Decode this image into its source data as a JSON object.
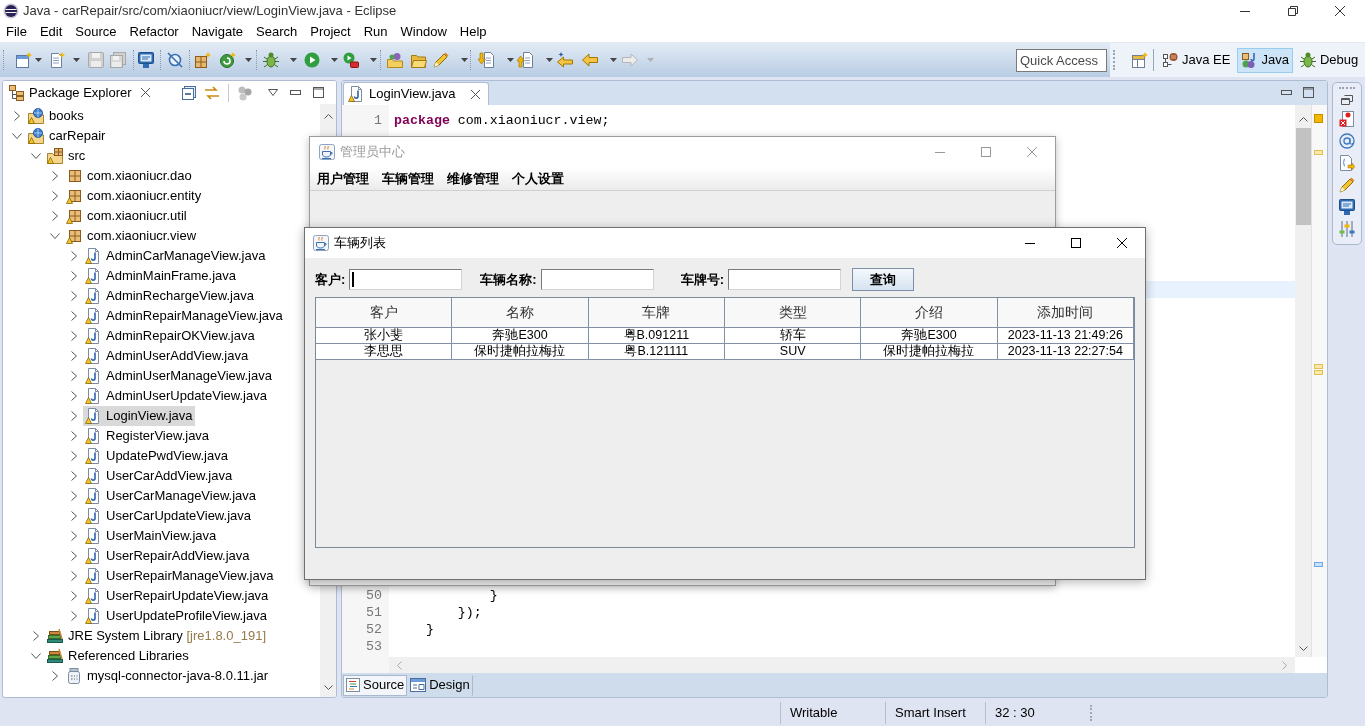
{
  "window": {
    "title": "Java - carRepair/src/com/xiaoniucr/view/LoginView.java - Eclipse"
  },
  "menu_bar": [
    "File",
    "Edit",
    "Source",
    "Refactor",
    "Navigate",
    "Search",
    "Project",
    "Run",
    "Window",
    "Help"
  ],
  "toolbar": {
    "quick_access": {
      "placeholder": "Quick Access"
    },
    "perspectives": [
      {
        "label": "Java EE",
        "selected": false
      },
      {
        "label": "Java",
        "selected": true
      },
      {
        "label": "Debug",
        "selected": false
      }
    ]
  },
  "package_explorer": {
    "title": "Package Explorer",
    "tree": [
      {
        "label": "books",
        "kind": "project",
        "expanded": false,
        "selected": false,
        "warning": true
      },
      {
        "label": "carRepair",
        "kind": "project",
        "expanded": true,
        "selected": false,
        "warning": true,
        "children": [
          {
            "label": "src",
            "kind": "source_folder",
            "expanded": true,
            "selected": false,
            "warning": true,
            "children": [
              {
                "label": "com.xiaoniucr.dao",
                "kind": "package",
                "expanded": false,
                "selected": false,
                "warning": false
              },
              {
                "label": "com.xiaoniucr.entity",
                "kind": "package",
                "expanded": false,
                "selected": false,
                "warning": true
              },
              {
                "label": "com.xiaoniucr.util",
                "kind": "package",
                "expanded": false,
                "selected": false,
                "warning": true
              },
              {
                "label": "com.xiaoniucr.view",
                "kind": "package",
                "expanded": true,
                "selected": false,
                "warning": true,
                "children": [
                  {
                    "label": "AdminCarManageView.java",
                    "kind": "java_file",
                    "expanded": false,
                    "selected": false,
                    "warning": true
                  },
                  {
                    "label": "AdminMainFrame.java",
                    "kind": "java_file",
                    "expanded": false,
                    "selected": false,
                    "warning": true
                  },
                  {
                    "label": "AdminRechargeView.java",
                    "kind": "java_file",
                    "expanded": false,
                    "selected": false,
                    "warning": true
                  },
                  {
                    "label": "AdminRepairManageView.java",
                    "kind": "java_file",
                    "expanded": false,
                    "selected": false,
                    "warning": true
                  },
                  {
                    "label": "AdminRepairOKView.java",
                    "kind": "java_file",
                    "expanded": false,
                    "selected": false,
                    "warning": true
                  },
                  {
                    "label": "AdminUserAddView.java",
                    "kind": "java_file",
                    "expanded": false,
                    "selected": false,
                    "warning": true
                  },
                  {
                    "label": "AdminUserManageView.java",
                    "kind": "java_file",
                    "expanded": false,
                    "selected": false,
                    "warning": true
                  },
                  {
                    "label": "AdminUserUpdateView.java",
                    "kind": "java_file",
                    "expanded": false,
                    "selected": false,
                    "warning": true
                  },
                  {
                    "label": "LoginView.java",
                    "kind": "java_file",
                    "expanded": false,
                    "selected": true,
                    "warning": true
                  },
                  {
                    "label": "RegisterView.java",
                    "kind": "java_file",
                    "expanded": false,
                    "selected": false,
                    "warning": true
                  },
                  {
                    "label": "UpdatePwdView.java",
                    "kind": "java_file",
                    "expanded": false,
                    "selected": false,
                    "warning": true
                  },
                  {
                    "label": "UserCarAddView.java",
                    "kind": "java_file",
                    "expanded": false,
                    "selected": false,
                    "warning": true
                  },
                  {
                    "label": "UserCarManageView.java",
                    "kind": "java_file",
                    "expanded": false,
                    "selected": false,
                    "warning": true
                  },
                  {
                    "label": "UserCarUpdateView.java",
                    "kind": "java_file",
                    "expanded": false,
                    "selected": false,
                    "warning": true
                  },
                  {
                    "label": "UserMainView.java",
                    "kind": "java_file",
                    "expanded": false,
                    "selected": false,
                    "warning": true
                  },
                  {
                    "label": "UserRepairAddView.java",
                    "kind": "java_file",
                    "expanded": false,
                    "selected": false,
                    "warning": true
                  },
                  {
                    "label": "UserRepairManageView.java",
                    "kind": "java_file",
                    "expanded": false,
                    "selected": false,
                    "warning": true
                  },
                  {
                    "label": "UserRepairUpdateView.java",
                    "kind": "java_file",
                    "expanded": false,
                    "selected": false,
                    "warning": true
                  },
                  {
                    "label": "UserUpdateProfileView.java",
                    "kind": "java_file",
                    "expanded": false,
                    "selected": false,
                    "warning": true
                  }
                ]
              }
            ]
          },
          {
            "label": "JRE System Library",
            "decoration": "[jre1.8.0_191]",
            "kind": "library",
            "expanded": false,
            "selected": false,
            "warning": false
          },
          {
            "label": "Referenced Libraries",
            "kind": "library",
            "expanded": true,
            "selected": false,
            "warning": false,
            "children": [
              {
                "label": "mysql-connector-java-8.0.11.jar",
                "kind": "jar",
                "expanded": false,
                "selected": false,
                "warning": false
              }
            ]
          }
        ]
      }
    ]
  },
  "editor": {
    "tabs": [
      {
        "label": "LoginView.java",
        "selected": true,
        "warning": true
      }
    ],
    "lines_top": [
      {
        "number": "1",
        "tokens": [
          {
            "kind": "keyword",
            "text": "package"
          },
          {
            "kind": "plain",
            "text": " com.xiaoniucr.view;"
          }
        ]
      }
    ],
    "lines_bottom": [
      {
        "number": "50",
        "tokens": [
          {
            "kind": "plain",
            "text": "            }"
          }
        ]
      },
      {
        "number": "51",
        "tokens": [
          {
            "kind": "plain",
            "text": "        });"
          }
        ]
      },
      {
        "number": "52",
        "tokens": [
          {
            "kind": "plain",
            "text": "    }"
          }
        ]
      },
      {
        "number": "53"
      }
    ],
    "bottom_tabs": [
      {
        "label": "Source",
        "selected": true
      },
      {
        "label": "Design",
        "selected": false
      }
    ]
  },
  "admin_window": {
    "title": "管理员中心",
    "active": false,
    "menu": [
      "用户管理",
      "车辆管理",
      "维修管理",
      "个人设置"
    ]
  },
  "car_list_window": {
    "title": "车辆列表",
    "active": true,
    "filters": [
      {
        "label": "客户:",
        "focused": true
      },
      {
        "label": "车辆名称:",
        "focused": false
      },
      {
        "label": "车牌号:",
        "focused": false
      }
    ],
    "search_button": "查询",
    "table": {
      "columns": [
        "客户",
        "名称",
        "车牌",
        "类型",
        "介绍",
        "添加时间"
      ],
      "rows": [
        [
          "张小斐",
          "奔驰E300",
          "粤B.091211",
          "轿车",
          "奔驰E300",
          "2023-11-13 21:49:26"
        ],
        [
          "李思思",
          "保时捷帕拉梅拉",
          "粤B.121111",
          "SUV",
          "保时捷帕拉梅拉",
          "2023-11-13 22:27:54"
        ]
      ]
    }
  },
  "status_bar": [
    "Writable",
    "Smart Insert",
    "32 : 30"
  ]
}
